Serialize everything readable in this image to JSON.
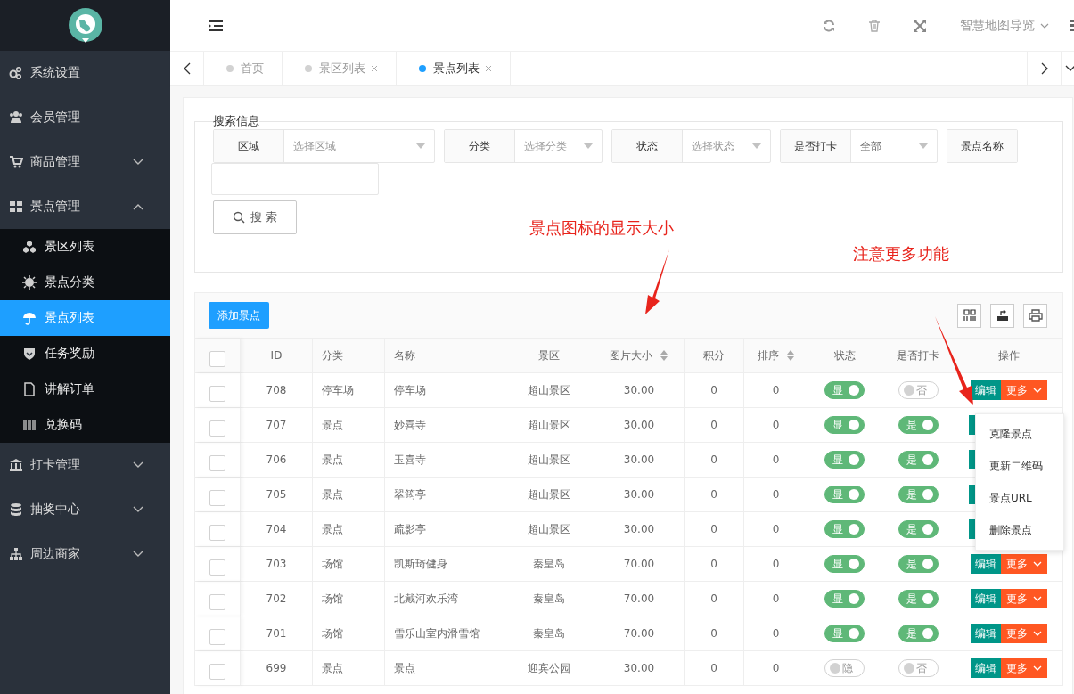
{
  "sidebar": {
    "items": [
      {
        "label": "系统设置"
      },
      {
        "label": "会员管理"
      },
      {
        "label": "商品管理",
        "expanded": false
      },
      {
        "label": "景点管理",
        "expanded": true,
        "children": [
          {
            "label": "景区列表",
            "selected": false
          },
          {
            "label": "景点分类",
            "selected": false
          },
          {
            "label": "景点列表",
            "selected": true
          },
          {
            "label": "任务奖励",
            "selected": false
          },
          {
            "label": "讲解订单",
            "selected": false
          },
          {
            "label": "兑换码",
            "selected": false
          }
        ]
      },
      {
        "label": "打卡管理",
        "expanded": false
      },
      {
        "label": "抽奖中心",
        "expanded": false
      },
      {
        "label": "周边商家",
        "expanded": false
      }
    ]
  },
  "header": {
    "user": "智慧地图导览"
  },
  "tabs": [
    {
      "label": "首页",
      "selected": false,
      "closable": false
    },
    {
      "label": "景区列表",
      "selected": false,
      "closable": true
    },
    {
      "label": "景点列表",
      "selected": true,
      "closable": true
    }
  ],
  "search": {
    "legend": "搜索信息",
    "fields": [
      {
        "label": "区域",
        "placeholder": "选择区域"
      },
      {
        "label": "分类",
        "placeholder": "选择分类"
      },
      {
        "label": "状态",
        "placeholder": "选择状态"
      },
      {
        "label": "是否打卡",
        "value": "全部"
      },
      {
        "label": "景点名称",
        "kind": "text"
      }
    ],
    "button": "搜 索"
  },
  "annotations": [
    {
      "text": "景点图标的显示大小"
    },
    {
      "text": "注意更多功能"
    }
  ],
  "toolbar": {
    "add_button": "添加景点"
  },
  "table": {
    "all_checked": false,
    "columns": [
      {
        "label": "ID"
      },
      {
        "label": "分类"
      },
      {
        "label": "名称"
      },
      {
        "label": "景区"
      },
      {
        "label": "图片大小",
        "sortable": true
      },
      {
        "label": "积分"
      },
      {
        "label": "排序",
        "sortable": true
      },
      {
        "label": "状态"
      },
      {
        "label": "是否打卡"
      },
      {
        "label": "操作"
      }
    ],
    "rows": [
      {
        "checked": false,
        "id": "708",
        "category": "停车场",
        "name": "停车场",
        "area": "超山景区",
        "size": "30.00",
        "points": "0",
        "sort": "0",
        "status": {
          "label": "显",
          "on": true
        },
        "checkin": {
          "label": "否",
          "on": false
        },
        "actions": [
          "编辑",
          "更多"
        ]
      },
      {
        "checked": false,
        "id": "707",
        "category": "景点",
        "name": "妙喜寺",
        "area": "超山景区",
        "size": "30.00",
        "points": "0",
        "sort": "0",
        "status": {
          "label": "显",
          "on": true
        },
        "checkin": {
          "label": "是",
          "on": true
        }
      },
      {
        "checked": false,
        "id": "706",
        "category": "景点",
        "name": "玉喜寺",
        "area": "超山景区",
        "size": "30.00",
        "points": "0",
        "sort": "0",
        "status": {
          "label": "显",
          "on": true
        },
        "checkin": {
          "label": "是",
          "on": true
        }
      },
      {
        "checked": false,
        "id": "705",
        "category": "景点",
        "name": "翠筠亭",
        "area": "超山景区",
        "size": "30.00",
        "points": "0",
        "sort": "0",
        "status": {
          "label": "显",
          "on": true
        },
        "checkin": {
          "label": "是",
          "on": true
        }
      },
      {
        "checked": false,
        "id": "704",
        "category": "景点",
        "name": "疏影亭",
        "area": "超山景区",
        "size": "30.00",
        "points": "0",
        "sort": "0",
        "status": {
          "label": "显",
          "on": true
        },
        "checkin": {
          "label": "是",
          "on": true
        }
      },
      {
        "checked": false,
        "id": "703",
        "category": "场馆",
        "name": "凯斯琦健身",
        "area": "秦皇岛",
        "size": "70.00",
        "points": "0",
        "sort": "0",
        "status": {
          "label": "显",
          "on": true
        },
        "checkin": {
          "label": "是",
          "on": true
        },
        "actions": [
          "编辑",
          "更多"
        ]
      },
      {
        "checked": false,
        "id": "702",
        "category": "场馆",
        "name": "北戴河欢乐湾",
        "area": "秦皇岛",
        "size": "70.00",
        "points": "0",
        "sort": "0",
        "status": {
          "label": "显",
          "on": true
        },
        "checkin": {
          "label": "是",
          "on": true
        },
        "actions": [
          "编辑",
          "更多"
        ]
      },
      {
        "checked": false,
        "id": "701",
        "category": "场馆",
        "name": "雪乐山室内滑雪馆",
        "area": "秦皇岛",
        "size": "70.00",
        "points": "0",
        "sort": "0",
        "status": {
          "label": "显",
          "on": true
        },
        "checkin": {
          "label": "是",
          "on": true
        },
        "actions": [
          "编辑",
          "更多"
        ]
      },
      {
        "checked": false,
        "id": "699",
        "category": "景点",
        "name": "景点",
        "area": "迎宾公园",
        "size": "30.00",
        "points": "0",
        "sort": "0",
        "status": {
          "label": "隐",
          "on": false
        },
        "checkin": {
          "label": "否",
          "on": false
        },
        "actions": [
          "编辑",
          "更多"
        ]
      }
    ],
    "more_menu": [
      "克隆景点",
      "更新二维码",
      "景点URL",
      "删除景点"
    ]
  }
}
